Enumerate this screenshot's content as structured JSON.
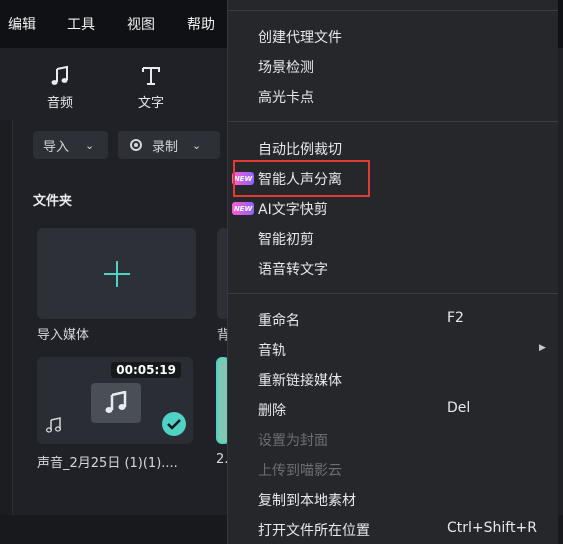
{
  "menubar": {
    "items": [
      "编辑",
      "工具",
      "视图",
      "帮助"
    ]
  },
  "toolbar": {
    "audio_label": "音频",
    "text_label": "文字"
  },
  "media_bar": {
    "import_label": "导入",
    "record_label": "录制"
  },
  "folder": {
    "title": "文件夹",
    "import_tile_label": "导入媒体",
    "partial_label_top": "背",
    "audio_tile": {
      "duration": "00:05:19",
      "label": "声音_2月25日 (1)(1)....",
      "partial_label": "2."
    }
  },
  "context_menu": {
    "group1": [
      "创建代理文件",
      "场景检测",
      "高光卡点"
    ],
    "group2": [
      {
        "label": "自动比例裁切",
        "badge": ""
      },
      {
        "label": "智能人声分离",
        "badge": "NEW"
      },
      {
        "label": "AI文字快剪",
        "badge": "NEW"
      },
      {
        "label": "智能初剪",
        "badge": ""
      },
      {
        "label": "语音转文字",
        "badge": ""
      }
    ],
    "group3": [
      {
        "label": "重命名",
        "shortcut": "F2",
        "disabled": false
      },
      {
        "label": "音轨",
        "shortcut": "",
        "disabled": false,
        "submenu": true
      },
      {
        "label": "重新链接媒体",
        "shortcut": "",
        "disabled": false
      },
      {
        "label": "删除",
        "shortcut": "Del",
        "disabled": false
      },
      {
        "label": "设置为封面",
        "shortcut": "",
        "disabled": true
      },
      {
        "label": "上传到喵影云",
        "shortcut": "",
        "disabled": true
      },
      {
        "label": "复制到本地素材",
        "shortcut": "",
        "disabled": false
      },
      {
        "label": "打开文件所在位置",
        "shortcut": "Ctrl+Shift+R",
        "disabled": false
      }
    ]
  },
  "colors": {
    "accent": "#4fd1c5",
    "highlight": "#e53935",
    "badge_start": "#ff5bd1",
    "badge_end": "#8c63ff"
  }
}
